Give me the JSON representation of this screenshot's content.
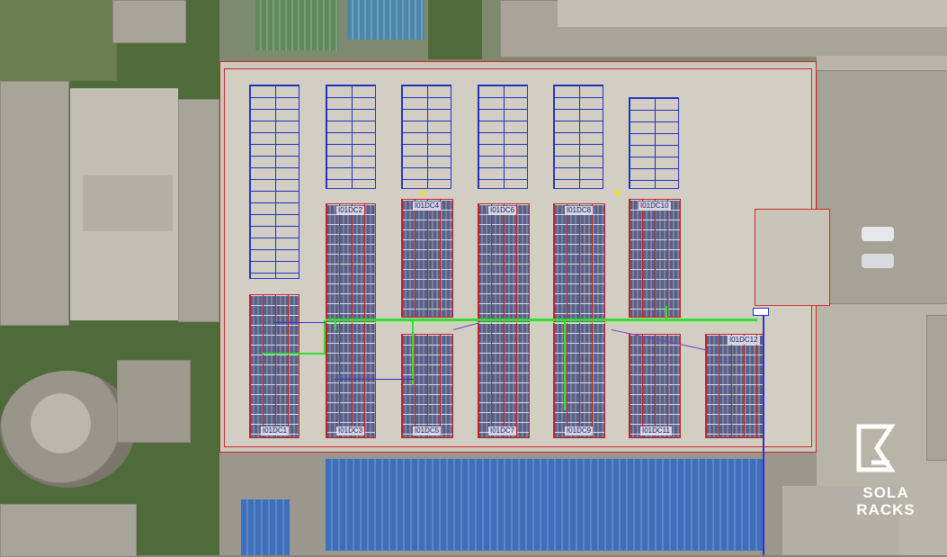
{
  "arrays": {
    "labels": [
      "I01DC1",
      "I01DC2",
      "I01DC3",
      "I01DC4",
      "I01DC5",
      "I01DC6",
      "I01DC7",
      "I01DC8",
      "I01DC9",
      "I01DC10",
      "I01DC11",
      "I01DC12"
    ]
  },
  "brand": {
    "line1": "SOLA",
    "line2": "RACKS"
  },
  "colors": {
    "installed_outline": "#c42222",
    "planned_outline": "#2233bb",
    "dc_cable": "#33dd33",
    "ac_cable": "#3333cc"
  }
}
